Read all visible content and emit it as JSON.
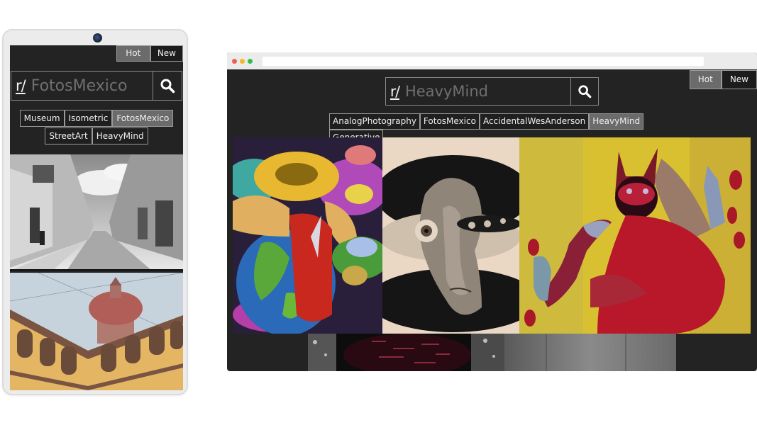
{
  "phone": {
    "sort": {
      "hot_label": "Hot",
      "new_label": "New",
      "active": "Hot"
    },
    "search": {
      "prefix": "r/",
      "value": "FotosMexico"
    },
    "subreddit_chips": [
      {
        "label": "Museum",
        "active": false
      },
      {
        "label": "Isometric",
        "active": false
      },
      {
        "label": "FotosMexico",
        "active": true
      },
      {
        "label": "StreetArt",
        "active": false
      },
      {
        "label": "HeavyMind",
        "active": false
      }
    ],
    "posts": [
      {
        "image": "black-and-white colonial street photo"
      },
      {
        "image": "courtyard arches with red dome church"
      }
    ]
  },
  "browser": {
    "window_controls": [
      "close",
      "minimize",
      "maximize"
    ],
    "sort": {
      "hot_label": "Hot",
      "new_label": "New",
      "active": "Hot"
    },
    "search": {
      "prefix": "r/",
      "value": "HeavyMind"
    },
    "subreddit_chips": [
      {
        "label": "AnalogPhotography",
        "active": false
      },
      {
        "label": "FotosMexico",
        "active": false
      },
      {
        "label": "AccidentalWesAnderson",
        "active": false
      },
      {
        "label": "HeavyMind",
        "active": true
      },
      {
        "label": "Generative",
        "active": false
      }
    ],
    "posts": [
      {
        "image": "surreal painting: figure with zodiac wheel head hugging globe"
      },
      {
        "image": "pen drawing: distorted face with many eyes"
      },
      {
        "image": "painting: red horned creature on yellow background"
      },
      {
        "image": "dark textured artwork with red strokes"
      },
      {
        "image": "grey wall panels"
      }
    ]
  },
  "colors": {
    "background": "#232323",
    "active_chip": "#6b6b6b",
    "border": "#9a9a9a",
    "text": "#efefef",
    "muted_text": "#6f6f6f"
  }
}
